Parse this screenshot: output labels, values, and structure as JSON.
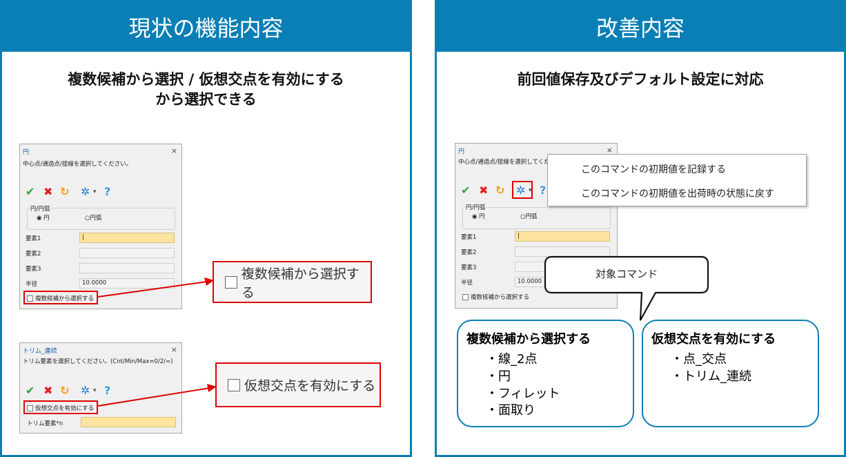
{
  "left_panel": {
    "title": "現状の機能内容",
    "subtitle_line1": "複数候補から選択 / 仮想交点を有効にする",
    "subtitle_line2": "から選択できる",
    "dialog1": {
      "title": "円",
      "instruction": "中心点/通過点/接線を選択してください。",
      "group_label": "円/円弧",
      "radio_circle": "円",
      "radio_arc": "円弧",
      "field1_label": "要素1",
      "field2_label": "要素2",
      "field3_label": "要素3",
      "radius_label": "半径",
      "radius_value": "10.0000",
      "checkbox_label": "複数候補から選択する"
    },
    "callout1": "複数候補から選択する",
    "dialog2": {
      "title": "トリム_連続",
      "instruction": "トリム要素を選択してください。(Cnt/Min/Max=0/2/∞)",
      "checkbox_label": "仮想交点を有効にする",
      "field_label": "トリム要素*n"
    },
    "callout2": "仮想交点を有効にする"
  },
  "right_panel": {
    "title": "改善内容",
    "subtitle": "前回値保存及びデフォルト設定に対応",
    "dialog": {
      "title": "円",
      "instruction": "中心点/通過点/接線を選択してくださ",
      "group_label": "円/円弧",
      "radio_circle": "円",
      "radio_arc": "円弧",
      "field1_label": "要素1",
      "field2_label": "要素2",
      "field3_label": "要素3",
      "radius_label": "半径",
      "radius_value": "10.0000",
      "checkbox_label": "複数候補から選択する"
    },
    "menu": {
      "item1": "このコマンドの初期値を記録する",
      "item2": "このコマンドの初期値を出荷時の状態に戻す"
    },
    "speech_bubble": "対象コマンド",
    "box1": {
      "heading": "複数候補から選択する",
      "items": [
        "・線_2点",
        "・円",
        "・フィレット",
        "・面取り"
      ]
    },
    "box2": {
      "heading": "仮想交点を有効にする",
      "items": [
        "・点_交点",
        "・トリム_連続"
      ]
    }
  },
  "icons": {
    "close": "×",
    "ok": "✔",
    "cancel": "✖",
    "refresh": "↻",
    "gear": "✲",
    "dropdown": "▾",
    "help": "?"
  },
  "colors": {
    "accent": "#0a7fb5",
    "highlight_red": "#e00000",
    "active_field": "#fde5a0"
  }
}
